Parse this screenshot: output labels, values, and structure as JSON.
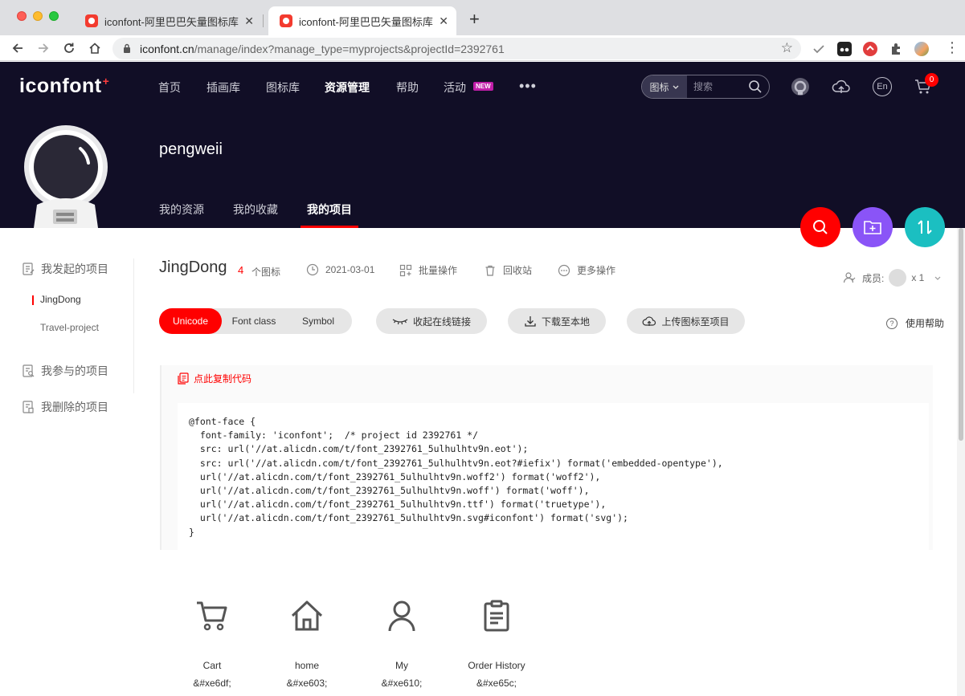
{
  "browser": {
    "tabs": [
      {
        "title": "iconfont-阿里巴巴矢量图标库",
        "active": false
      },
      {
        "title": "iconfont-阿里巴巴矢量图标库",
        "active": true
      }
    ],
    "url_host": "iconfont.cn",
    "url_path": "/manage/index?manage_type=myprojects&projectId=2392761"
  },
  "site": {
    "logo": "iconfont",
    "logo_mark": "+",
    "nav": [
      "首页",
      "插画库",
      "图标库",
      "资源管理",
      "帮助",
      "活动"
    ],
    "nav_active_index": 3,
    "new_badge": "NEW",
    "more": "•••",
    "search_type": "图标",
    "search_placeholder": "搜索",
    "cart_count": "0",
    "lang_icon": "En"
  },
  "user": {
    "name": "pengweii",
    "tabs": [
      "我的资源",
      "我的收藏",
      "我的项目"
    ],
    "active_tab_index": 2
  },
  "sidebar": {
    "started_title": "我发起的项目",
    "projects": [
      "JingDong",
      "Travel-project"
    ],
    "joined_title": "我参与的项目",
    "deleted_title": "我删除的项目"
  },
  "project": {
    "name": "JingDong",
    "icon_count": "4",
    "icon_count_unit": "个图标",
    "date": "2021-03-01",
    "batch": "批量操作",
    "recycle": "回收站",
    "more_ops": "更多操作",
    "members_label": "成员:",
    "members_count": "x 1"
  },
  "actions": {
    "modes": [
      "Unicode",
      "Font class",
      "Symbol"
    ],
    "active_mode": "Unicode",
    "collapse_link": "收起在线链接",
    "download": "下载至本地",
    "upload": "上传图标至项目",
    "help": "使用帮助"
  },
  "code": {
    "copy_label": "点此复制代码",
    "text": "@font-face {\n  font-family: 'iconfont';  /* project id 2392761 */\n  src: url('//at.alicdn.com/t/font_2392761_5ulhulhtv9n.eot');\n  src: url('//at.alicdn.com/t/font_2392761_5ulhulhtv9n.eot?#iefix') format('embedded-opentype'),\n  url('//at.alicdn.com/t/font_2392761_5ulhulhtv9n.woff2') format('woff2'),\n  url('//at.alicdn.com/t/font_2392761_5ulhulhtv9n.woff') format('woff'),\n  url('//at.alicdn.com/t/font_2392761_5ulhulhtv9n.ttf') format('truetype'),\n  url('//at.alicdn.com/t/font_2392761_5ulhulhtv9n.svg#iconfont') format('svg');\n}"
  },
  "icons": [
    {
      "name": "Cart",
      "code": "&#xe6df;",
      "icon": "cart-icon"
    },
    {
      "name": "home",
      "code": "&#xe603;",
      "icon": "home-icon"
    },
    {
      "name": "My",
      "code": "&#xe610;",
      "icon": "user-icon"
    },
    {
      "name": "Order History",
      "code": "&#xe65c;",
      "icon": "clipboard-list-icon"
    }
  ],
  "colors": {
    "brand_red": "#ff0000",
    "header_bg": "#110e26",
    "fab_purple": "#8a54f7",
    "fab_teal": "#1bbfc1"
  }
}
